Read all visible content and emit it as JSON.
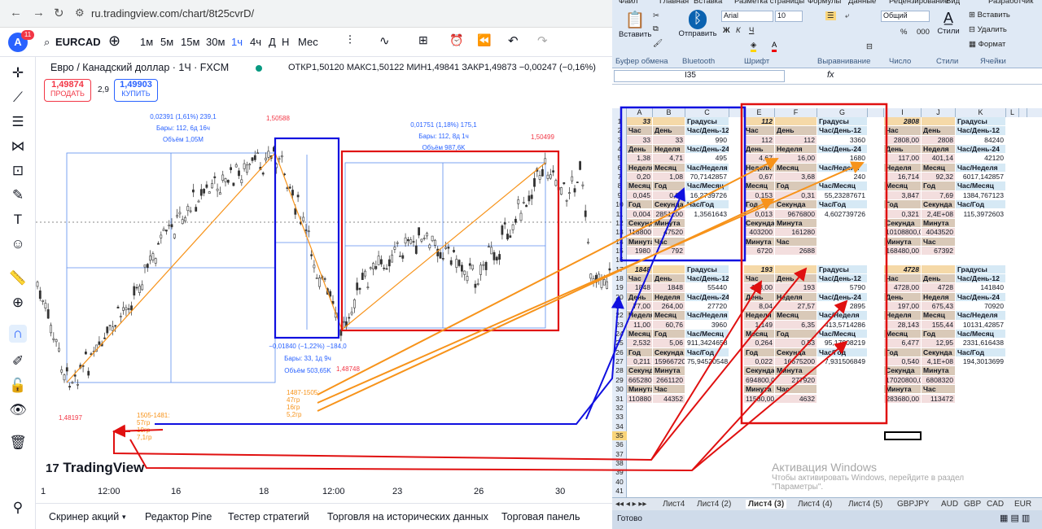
{
  "browser": {
    "url": "ru.tradingview.com/chart/8t25cvrD/"
  },
  "tv": {
    "avatar": "A",
    "badge": "11",
    "symbol": "EURCAD",
    "timeframes": [
      "1м",
      "5м",
      "15м",
      "30м",
      "1ч",
      "4ч",
      "Д",
      "Н",
      "Мес"
    ],
    "pair_title": "Евро / Канадский доллар · 1Ч · FXCM",
    "ohlc": "ОТКР1,50120 МАКС1,50122 МИН1,49841 ЗАКР1,49873 −0,00247 (−0,16%)",
    "sell_price": "1,49874",
    "sell_label": "ПРОДАТЬ",
    "spread": "2,9",
    "buy_price": "1,49903",
    "buy_label": "КУПИТЬ",
    "ann1": [
      "0,02391 (1,61%) 239,1",
      "Бары: 112, 6д 16ч",
      "Объём 1,05М"
    ],
    "ann2": [
      "0,01751 (1,18%) 175,1",
      "Бары: 112, 8д 1ч",
      "Объём 987,6K"
    ],
    "ann3": [
      "−0,01840 (−1,22%) −184,0",
      "Бары: 33, 1д 9ч",
      "Объём 503,65K"
    ],
    "p_high1": "1,50588",
    "p_high2": "1,50499",
    "p_low1": "1,48197",
    "p_low2": "1,48748",
    "orange_note": [
      "1487-1505:",
      "47гр",
      "16гр",
      "5,2гр"
    ],
    "orange_note2": [
      "1505-1481:",
      "57гр",
      "19гр",
      "7,1гр"
    ],
    "logo": "TradingView",
    "xaxis": [
      "1",
      "12:00",
      "16",
      "18",
      "12:00",
      "23",
      "26",
      "30"
    ],
    "bottom": [
      "Скринер акций",
      "Редактор Pine",
      "Тестер стратегий",
      "Торговля на исторических данных",
      "Торговая панель"
    ]
  },
  "xl": {
    "tabs": [
      "Файл",
      "Главная",
      "Вставка",
      "Разметка страницы",
      "Формулы",
      "Данные",
      "Рецензирование",
      "Вид",
      "Разработчик"
    ],
    "groups": [
      "Буфер обмена",
      "Bluetooth",
      "Шрифт",
      "Выравнивание",
      "Число",
      "Стили",
      "Ячейки"
    ],
    "paste": "Вставить",
    "send": "Отправить",
    "font": "Arial",
    "size": "10",
    "numfmt": "Общий",
    "styles": "Стили",
    "insert": "Вставить",
    "delete": "Удалить",
    "format": "Формат",
    "namebox": "I35",
    "cols": [
      "A",
      "B",
      "C",
      "E",
      "F",
      "G",
      "I",
      "J",
      "K",
      "L"
    ],
    "sheets": [
      "Лист4",
      "Лист4 (2)",
      "Лист4 (3)",
      "Лист4 (4)",
      "Лист4 (5)",
      "GBPJPY",
      "AUD",
      "GBP",
      "CAD",
      "EUR"
    ],
    "status": "Готово",
    "watermark": [
      "Активация Windows",
      "Чтобы активировать Windows, перейдите в раздел",
      "\"Параметры\"."
    ],
    "cells": [
      [
        "33",
        "",
        "",
        "Градусы",
        "112",
        "",
        "",
        "Градусы",
        "2808",
        "",
        "",
        "Градусы"
      ],
      [
        "Час",
        "День",
        "",
        "Час/День-12",
        "Час",
        "День",
        "",
        "Час/День-12",
        "Час",
        "День",
        "",
        "Час/День-12"
      ],
      [
        "33",
        "33",
        "",
        "990",
        "112",
        "112",
        "",
        "3360",
        "2808,00",
        "2808",
        "",
        "84240"
      ],
      [
        "День",
        "Неделя",
        "",
        "Час/День-24",
        "День",
        "Неделя",
        "",
        "Час/День-24",
        "День",
        "Неделя",
        "",
        "Час/День-24"
      ],
      [
        "1,38",
        "4,71",
        "",
        "495",
        "4,67",
        "16,00",
        "",
        "1680",
        "117,00",
        "401,14",
        "",
        "42120"
      ],
      [
        "Неделя",
        "Месяц",
        "",
        "Час/Неделя",
        "Неделя",
        "Месяц",
        "",
        "Час/Неделя",
        "Неделя",
        "Месяц",
        "",
        "Час/Неделя"
      ],
      [
        "0,20",
        "1,08",
        "",
        "70,7142857",
        "0,67",
        "3,68",
        "",
        "240",
        "16,714",
        "92,32",
        "",
        "6017,142857"
      ],
      [
        "Месяц",
        "Год",
        "",
        "Час/Месяц",
        "Месяц",
        "Год",
        "",
        "Час/Месяц",
        "Месяц",
        "Год",
        "",
        "Час/Месяц"
      ],
      [
        "0,045",
        "0,09",
        "",
        "16,2739726",
        "0,153",
        "0,31",
        "",
        "55,23287671",
        "3,847",
        "7,69",
        "",
        "1384,767123"
      ],
      [
        "Год",
        "Секунда",
        "",
        "Час/Год",
        "Год",
        "Секунда",
        "",
        "Час/Год",
        "Год",
        "Секунда",
        "",
        "Час/Год"
      ],
      [
        "0,004",
        "2851200",
        "",
        "1,3561643",
        "0,013",
        "9676800",
        "",
        "4,602739726",
        "0,321",
        "2,4E+08",
        "",
        "115,3972603"
      ],
      [
        "Секунда",
        "Минута",
        "",
        "",
        "Секунда",
        "Минута",
        "",
        "",
        "Секунда",
        "Минута",
        "",
        ""
      ],
      [
        "118800",
        "47520",
        "",
        "",
        "403200",
        "161280",
        "",
        "",
        "10108800,00",
        "4043520",
        "",
        ""
      ],
      [
        "Минута",
        "Час",
        "",
        "",
        "Минута",
        "Час",
        "",
        "",
        "Минута",
        "Час",
        "",
        ""
      ],
      [
        "1980",
        "792",
        "",
        "",
        "6720",
        "2688",
        "",
        "",
        "168480,00",
        "67392",
        "",
        ""
      ]
    ],
    "cells2": [
      [
        "1848",
        "",
        "",
        "Градусы",
        "193",
        "",
        "",
        "Градусы",
        "4728",
        "",
        "",
        "Градусы"
      ],
      [
        "Час",
        "День",
        "",
        "Час/День-12",
        "Час",
        "День",
        "",
        "Час/День-12",
        "Час",
        "День",
        "",
        "Час/День-12"
      ],
      [
        "1848",
        "1848",
        "",
        "55440",
        "193,00",
        "193",
        "",
        "5790",
        "4728,00",
        "4728",
        "",
        "141840"
      ],
      [
        "День",
        "Неделя",
        "",
        "Час/День-24",
        "День",
        "Неделя",
        "",
        "Час/День-24",
        "День",
        "Неделя",
        "",
        "Час/День-24"
      ],
      [
        "77,00",
        "264,00",
        "",
        "27720",
        "8,04",
        "27,57",
        "",
        "2895",
        "197,00",
        "675,43",
        "",
        "70920"
      ],
      [
        "Неделя",
        "Месяц",
        "",
        "Час/Неделя",
        "Неделя",
        "Месяц",
        "",
        "Час/Неделя",
        "Неделя",
        "Месяц",
        "",
        "Час/Неделя"
      ],
      [
        "11,00",
        "60,76",
        "",
        "3960",
        "1,149",
        "6,35",
        "",
        "413,5714286",
        "28,143",
        "155,44",
        "",
        "10131,42857"
      ],
      [
        "Месяц",
        "Год",
        "",
        "Час/Месяц",
        "Месяц",
        "Год",
        "",
        "Час/Месяц",
        "Месяц",
        "Год",
        "",
        "Час/Месяц"
      ],
      [
        "2,532",
        "5,06",
        "",
        "911,3424658",
        "0,264",
        "0,53",
        "",
        "95,17808219",
        "6,477",
        "12,95",
        "",
        "2331,616438"
      ],
      [
        "Год",
        "Секунда",
        "",
        "Час/Год",
        "Год",
        "Секунда",
        "",
        "Час/Год",
        "Год",
        "Секунда",
        "",
        "Час/Год"
      ],
      [
        "0,211",
        "159667200",
        "",
        "75,94520548",
        "0,022",
        "16675200",
        "",
        "7,931506849",
        "0,540",
        "4,1E+08",
        "",
        "194,3013699"
      ],
      [
        "Секунда",
        "Минута",
        "",
        "",
        "Секунда",
        "Минута",
        "",
        "",
        "Секунда",
        "Минута",
        "",
        ""
      ],
      [
        "6652800",
        "2661120",
        "",
        "",
        "694800,00",
        "277920",
        "",
        "",
        "17020800,00",
        "6808320",
        "",
        ""
      ],
      [
        "Минута",
        "Час",
        "",
        "",
        "Минута",
        "Час",
        "",
        "",
        "Минута",
        "Час",
        "",
        ""
      ],
      [
        "110880",
        "44352",
        "",
        "",
        "11580,00",
        "4632",
        "",
        "",
        "283680,00",
        "113472",
        "",
        ""
      ]
    ]
  }
}
